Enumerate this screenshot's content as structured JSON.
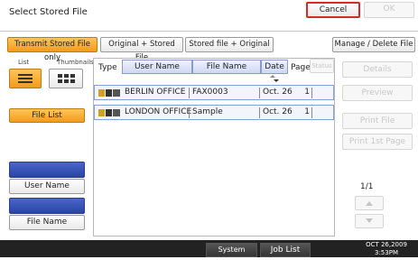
{
  "header": {
    "title": "Select Stored File",
    "cancel_label": "Cancel",
    "ok_label": "OK"
  },
  "tabs": [
    {
      "label": "Transmit Stored File only",
      "selected": true
    },
    {
      "label": "Original + Stored File",
      "selected": false
    },
    {
      "label": "Stored file + Original",
      "selected": false
    }
  ],
  "manage_label": "Manage / Delete File",
  "view": {
    "list_label": "List",
    "thumbnails_label": "Thumbnails"
  },
  "left": {
    "file_list_label": "File List",
    "user_name_label": "User Name",
    "file_name_label": "File Name"
  },
  "columns": {
    "type": "Type",
    "user_name": "User Name",
    "file_name": "File Name",
    "date": "Date",
    "page": "Page",
    "status": "Status"
  },
  "rows": [
    {
      "user": "BERLIN OFFICE",
      "file": "FAX0003",
      "date": "Oct. 26",
      "pages": "1"
    },
    {
      "user": "LONDON OFFICE",
      "file": "Sample",
      "date": "Oct. 26",
      "pages": "1"
    }
  ],
  "right": {
    "details": "Details",
    "preview": "Preview",
    "print_file": "Print File",
    "print_first": "Print 1st Page",
    "page_indicator": "1/1"
  },
  "statusbar": {
    "system_status": "System Status",
    "job_list": "Job List",
    "date": "OCT  26,2009",
    "time": "3:53PM"
  },
  "colors": {
    "accent": "#f29b1d",
    "blue": "#2a45a8",
    "status_bg": "#222222"
  }
}
